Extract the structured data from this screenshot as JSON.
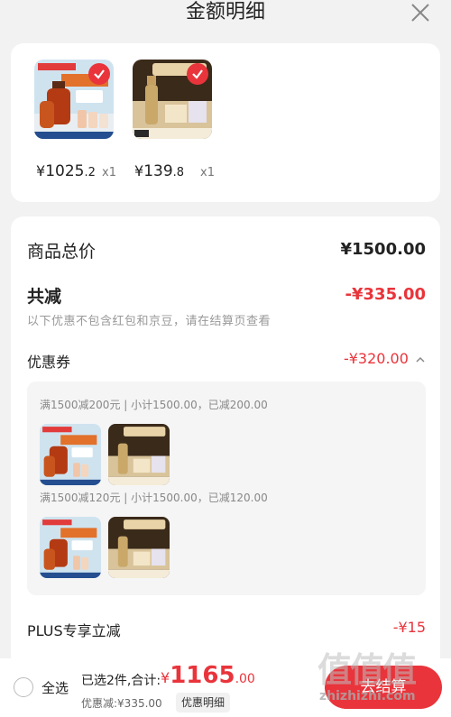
{
  "header": {
    "title": "金额明细"
  },
  "products": [
    {
      "currency": "¥",
      "price_int": "1025",
      "price_dec": ".2",
      "qty": "x1",
      "art": "serum"
    },
    {
      "currency": "¥",
      "price_int": "139",
      "price_dec": ".8",
      "qty": "x1",
      "art": "gold"
    }
  ],
  "summary": {
    "total_label": "商品总价",
    "total_value": "¥1500.00",
    "reduce_label": "共减",
    "reduce_value": "-¥335.00",
    "note": "以下优惠不包含红包和京豆，请在结算页查看",
    "coupon_label": "优惠券",
    "coupon_value": "-¥320.00",
    "coupon_groups": [
      {
        "label": "满1500减200元 | 小计1500.00，已减200.00"
      },
      {
        "label": "满1500减120元 | 小计1500.00，已减120.00"
      }
    ],
    "plus_label": "PLUS专享立减",
    "plus_value": "-¥15"
  },
  "footer": {
    "select_all": "全选",
    "selected_text": "已选2件,合计:",
    "total_currency": "¥",
    "total_int": "1165",
    "total_dec": ".00",
    "saved_text": "优惠减:¥335.00",
    "detail_button": "优惠明细",
    "settle_button": "去结算"
  },
  "watermark": {
    "glyphs": "值值值",
    "url": "zhizhizhi.com"
  },
  "colors": {
    "accent": "#e9343b",
    "text": "#222222",
    "muted": "#999999"
  },
  "icons": [
    "close-icon",
    "check-icon",
    "chevron-up-icon",
    "radio-icon"
  ]
}
